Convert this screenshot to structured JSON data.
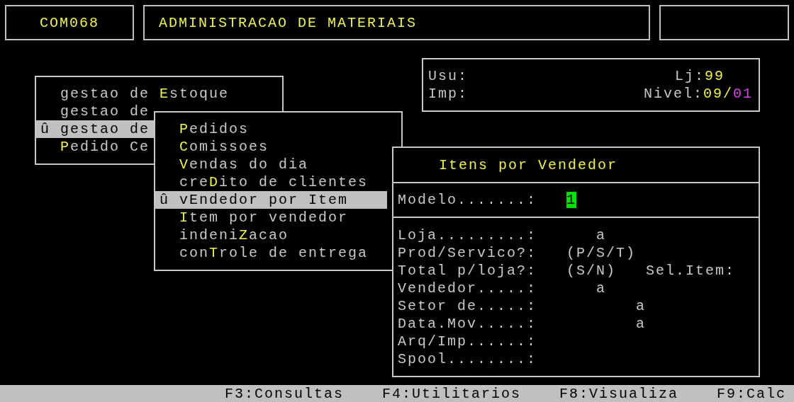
{
  "header": {
    "program_code": "COM068",
    "system_title": "ADMINISTRACAO DE MATERIAIS"
  },
  "session": {
    "rows": [
      {
        "label": "Usu:",
        "right_label": "Lj:",
        "right_value": [
          {
            "text": "99",
            "color": "#f0f050"
          }
        ]
      },
      {
        "label": "Imp:",
        "right_label": "Nivel:",
        "right_value": [
          {
            "text": "09/",
            "color": "#f0f050"
          },
          {
            "text": "01",
            "color": "#e040f0"
          }
        ]
      }
    ]
  },
  "main_menu": {
    "items": [
      {
        "before": "gestao de ",
        "key": "E",
        "after": "stoque",
        "selected": false
      },
      {
        "before": "gestao de",
        "selected": false
      },
      {
        "marker": "û",
        "before": "gestao de",
        "selected": true
      },
      {
        "key": "P",
        "after": "edido Ce",
        "selected": false
      }
    ]
  },
  "submenu": {
    "items": [
      {
        "key": "P",
        "after": "edidos",
        "selected": false
      },
      {
        "key": "C",
        "after": "omissoes",
        "selected": false
      },
      {
        "key": "V",
        "after": "endas do dia",
        "selected": false
      },
      {
        "before": "cre",
        "key": "D",
        "after": "ito de clientes",
        "selected": false
      },
      {
        "marker": "û",
        "before": "v",
        "key": "E",
        "after": "ndedor por Item",
        "selected": true
      },
      {
        "key": "I",
        "after": "tem por vendedor",
        "selected": false
      },
      {
        "before": "indeni",
        "key": "Z",
        "after": "acao",
        "selected": false
      },
      {
        "before": "con",
        "key": "T",
        "after": "role de entrega",
        "selected": false
      }
    ]
  },
  "form": {
    "title": "Itens por Vendedor",
    "model": {
      "label": "Modelo.......:",
      "value": "1"
    },
    "fields": [
      {
        "label": "Loja.........:",
        "value": "a"
      },
      {
        "label": "Prod/Servico?:",
        "value": "(P/S/T)"
      },
      {
        "label": "Total p/loja?:",
        "value": "(S/N)",
        "extra": "Sel.Item:"
      },
      {
        "label": "Vendedor.....:",
        "value": "a"
      },
      {
        "label": "Setor de.....:",
        "value": "a"
      },
      {
        "label": "Data.Mov.....:",
        "value": "a"
      },
      {
        "label": "Arq/Imp......:"
      },
      {
        "label": "Spool........:"
      }
    ]
  },
  "status_bar": {
    "keys": [
      "F3:Consultas",
      "F4:Utilitarios",
      "F8:Visualiza",
      "F9:Calc"
    ]
  }
}
